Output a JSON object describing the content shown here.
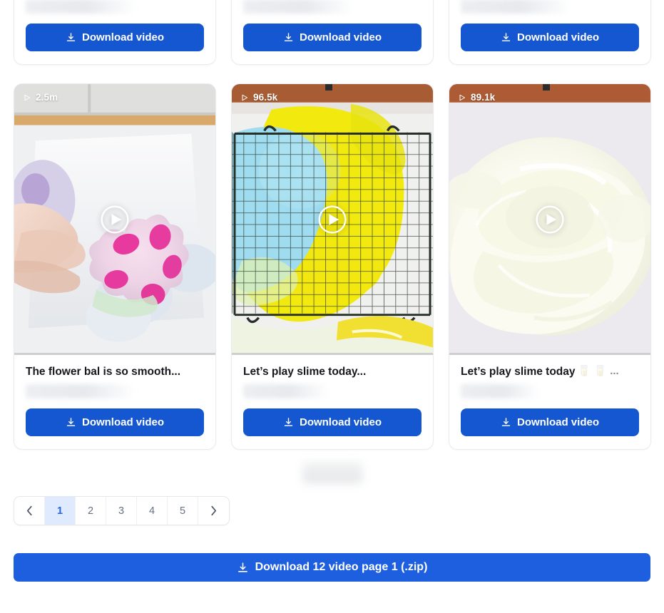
{
  "results": {
    "row_top": [
      {
        "download_label": "Download video"
      },
      {
        "download_label": "Download video"
      },
      {
        "download_label": "Download video"
      }
    ],
    "row_main": [
      {
        "views": "2.5m",
        "play_icon": "play-triangle-icon",
        "title": "The flower bal is so smooth...",
        "title_emoji": "",
        "download_label": "Download video"
      },
      {
        "views": "96.5k",
        "play_icon": "play-triangle-icon",
        "title": "Let’s play slime today...",
        "title_emoji": "",
        "download_label": "Download video"
      },
      {
        "views": "89.1k",
        "play_icon": "play-triangle-icon",
        "title": "Let’s play slime today",
        "title_emoji": "🥛 🥛 ...",
        "download_label": "Download video"
      }
    ]
  },
  "pagination": {
    "prev_label": "‹",
    "next_label": "›",
    "pages": [
      "1",
      "2",
      "3",
      "4",
      "5"
    ],
    "current": "1"
  },
  "footer": {
    "zip_label": "Download 12 video page 1 (.zip)",
    "download_icon": "download-icon"
  },
  "colors": {
    "primary_blue": "#1557d0",
    "footer_blue": "#1e5fe0",
    "active_page_bg": "#dfeaff",
    "active_page_text": "#2563eb",
    "title_text": "#16181d"
  }
}
